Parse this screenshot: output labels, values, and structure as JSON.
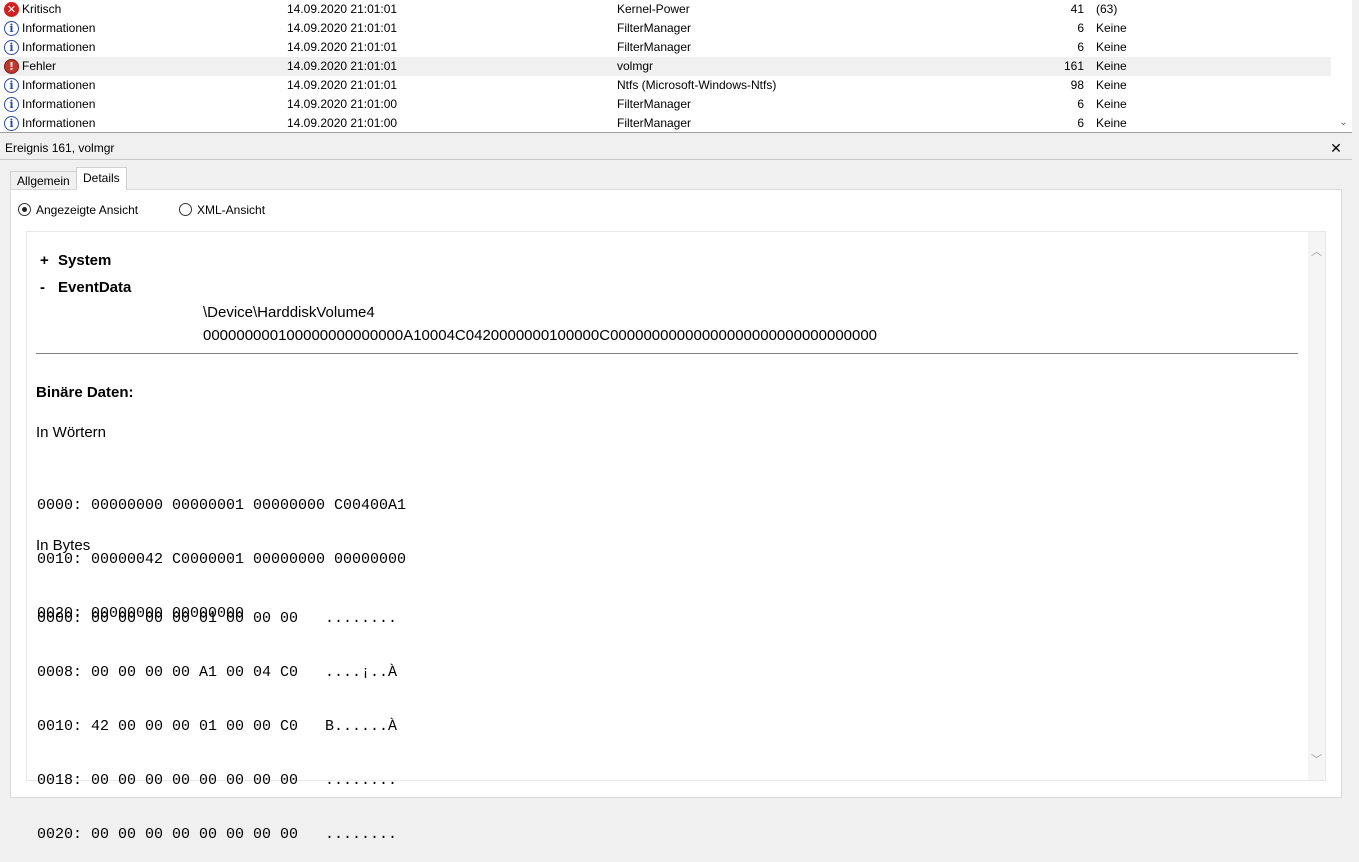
{
  "event_list": {
    "rows": [
      {
        "level": "Kritisch",
        "level_icon": "critical-icon",
        "datetime": "14.09.2020 21:01:01",
        "source": "Kernel-Power",
        "event_id": "41",
        "task": "(63)",
        "selected": false
      },
      {
        "level": "Informationen",
        "level_icon": "info-icon",
        "datetime": "14.09.2020 21:01:01",
        "source": "FilterManager",
        "event_id": "6",
        "task": "Keine",
        "selected": false
      },
      {
        "level": "Informationen",
        "level_icon": "info-icon",
        "datetime": "14.09.2020 21:01:01",
        "source": "FilterManager",
        "event_id": "6",
        "task": "Keine",
        "selected": false
      },
      {
        "level": "Fehler",
        "level_icon": "error-icon",
        "datetime": "14.09.2020 21:01:01",
        "source": "volmgr",
        "event_id": "161",
        "task": "Keine",
        "selected": true
      },
      {
        "level": "Informationen",
        "level_icon": "info-icon",
        "datetime": "14.09.2020 21:01:01",
        "source": "Ntfs (Microsoft-Windows-Ntfs)",
        "event_id": "98",
        "task": "Keine",
        "selected": false
      },
      {
        "level": "Informationen",
        "level_icon": "info-icon",
        "datetime": "14.09.2020 21:01:00",
        "source": "FilterManager",
        "event_id": "6",
        "task": "Keine",
        "selected": false
      },
      {
        "level": "Informationen",
        "level_icon": "info-icon",
        "datetime": "14.09.2020 21:01:00",
        "source": "FilterManager",
        "event_id": "6",
        "task": "Keine",
        "selected": false
      }
    ]
  },
  "details": {
    "title": "Ereignis 161, volmgr",
    "close_symbol": "✕",
    "tabs": {
      "general": "Allgemein",
      "details": "Details"
    },
    "view_options": {
      "friendly": "Angezeigte Ansicht",
      "xml": "XML-Ansicht",
      "selected": "friendly"
    },
    "tree": {
      "system": {
        "toggle": "+",
        "label": "System"
      },
      "eventdata": {
        "toggle": "-",
        "label": "EventData",
        "values": [
          "\\Device\\HarddiskVolume4",
          "000000000100000000000000A10004C0420000000100000C00000000000000000000000000000000"
        ]
      }
    },
    "binary": {
      "title": "Binäre Daten:",
      "words_title": "In Wörtern",
      "words_lines": [
        "0000: 00000000 00000001 00000000 C00400A1",
        "0010: 00000042 C0000001 00000000 00000000",
        "0020: 00000000 00000000"
      ],
      "bytes_title": "In Bytes",
      "bytes_lines": [
        "0000: 00 00 00 00 01 00 00 00   ........",
        "0008: 00 00 00 00 A1 00 04 C0   ....¡..À",
        "0010: 42 00 00 00 01 00 00 C0   B......À",
        "0018: 00 00 00 00 00 00 00 00   ........",
        "0020: 00 00 00 00 00 00 00 00   ........"
      ]
    }
  },
  "colors": {
    "critical": "#d02020",
    "error": "#c0392b",
    "info": "#2b4a9e",
    "selected_row": "#f0f0f0"
  }
}
